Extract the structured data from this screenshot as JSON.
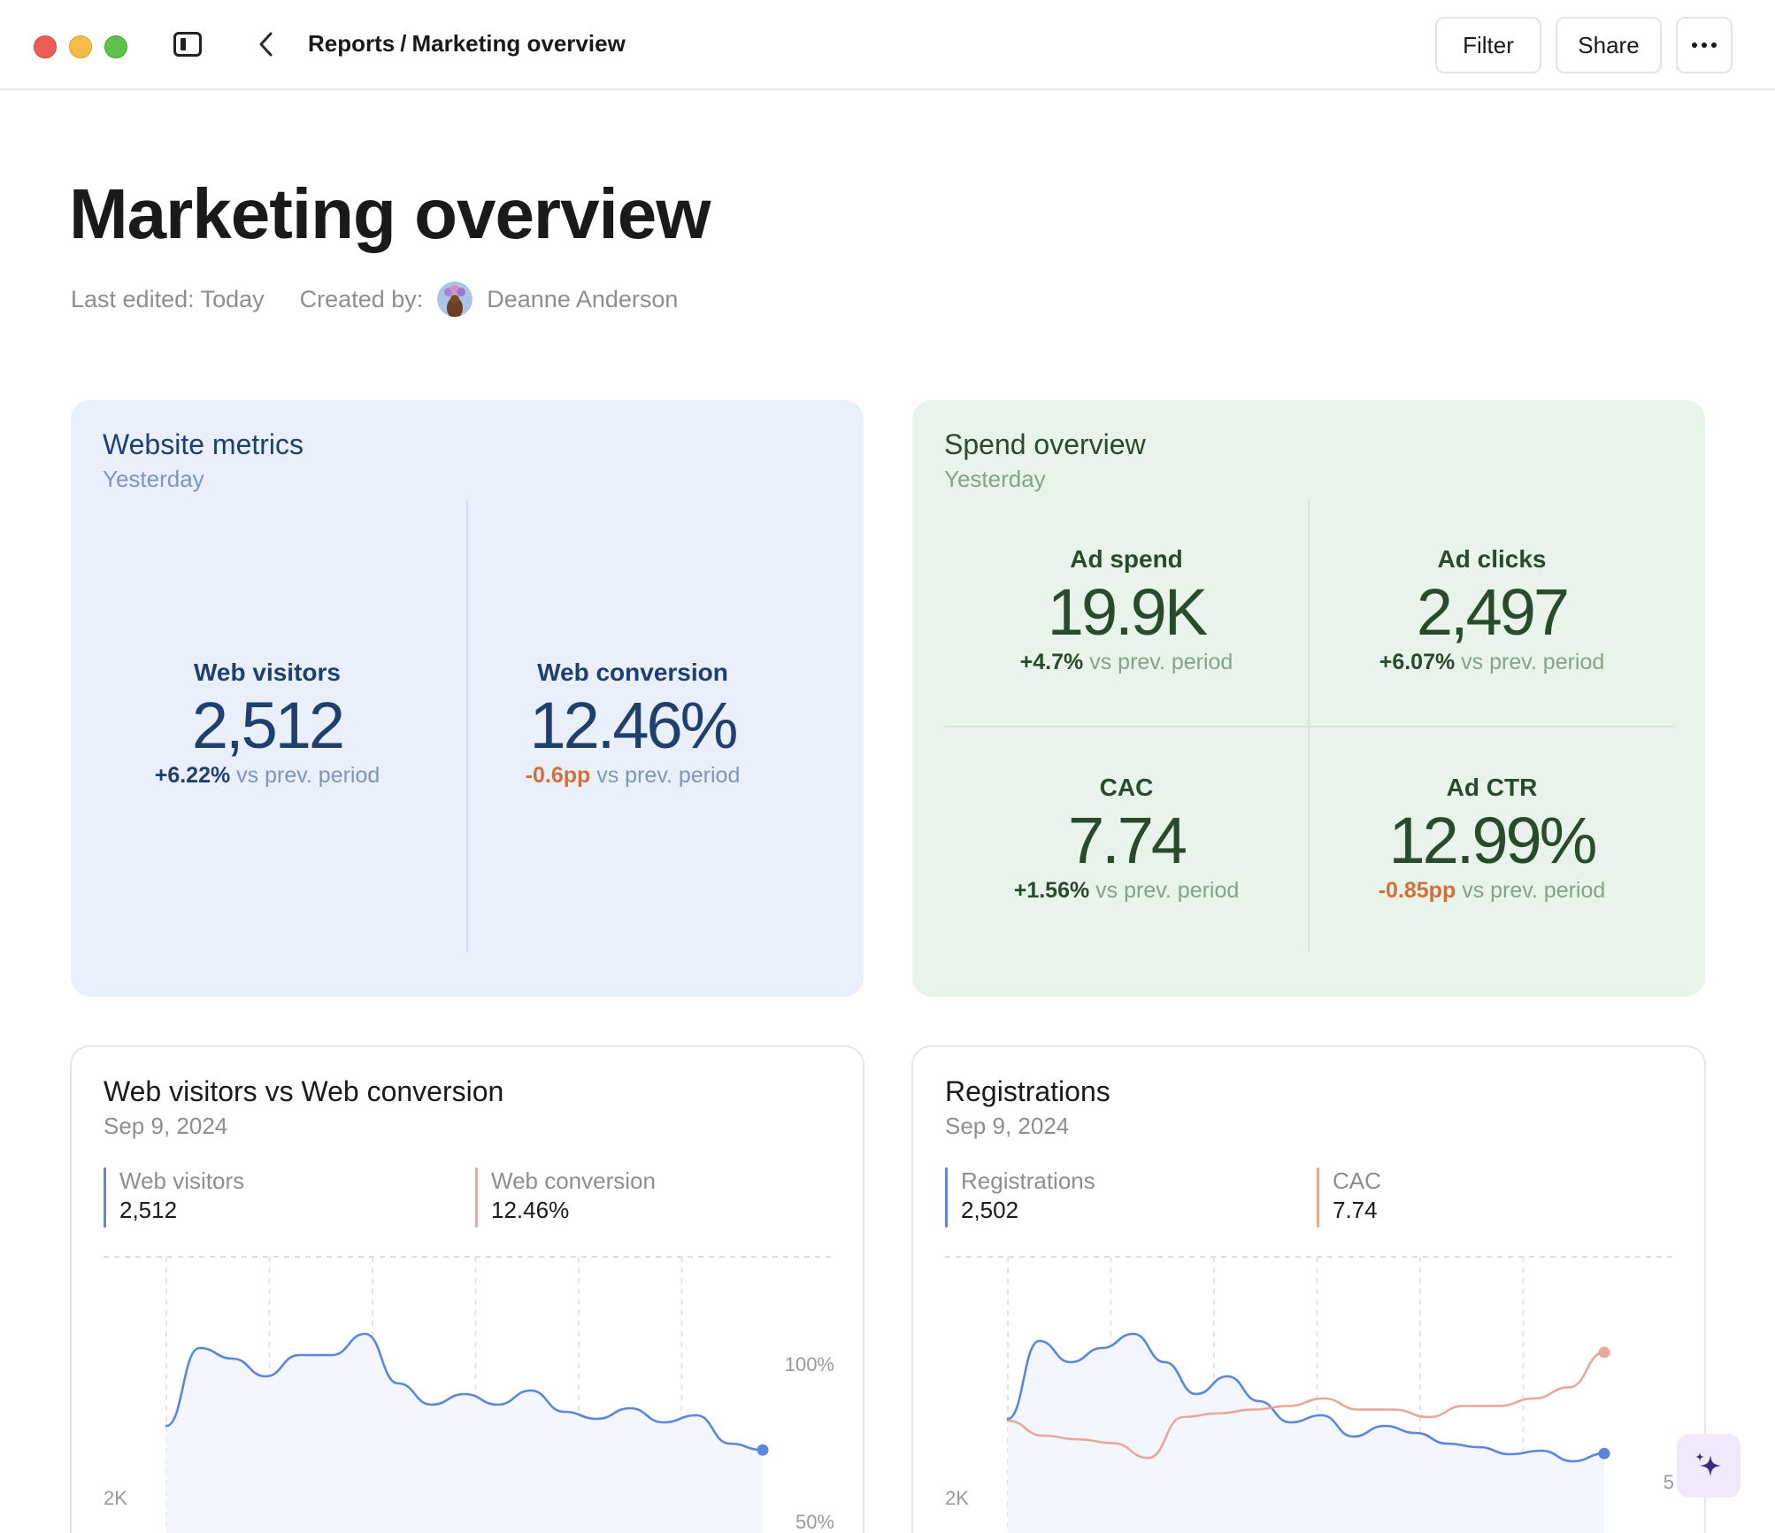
{
  "topbar": {
    "breadcrumb_parent": "Reports",
    "breadcrumb_sep": "/",
    "breadcrumb_current": "Marketing overview",
    "filter_label": "Filter",
    "share_label": "Share"
  },
  "header": {
    "title": "Marketing overview",
    "last_edited": "Last edited: Today",
    "created_by_label": "Created by:",
    "author": "Deanne Anderson"
  },
  "website_metrics": {
    "title": "Website metrics",
    "subtitle": "Yesterday",
    "metrics": [
      {
        "label": "Web visitors",
        "value": "2,512",
        "delta": "+6.22%",
        "delta_suffix": "vs prev. period"
      },
      {
        "label": "Web conversion",
        "value": "12.46%",
        "delta": "-0.6pp",
        "delta_suffix": "vs prev. period"
      }
    ]
  },
  "spend_overview": {
    "title": "Spend overview",
    "subtitle": "Yesterday",
    "metrics": [
      {
        "label": "Ad spend",
        "value": "19.9K",
        "delta": "+4.7%",
        "delta_suffix": "vs prev. period"
      },
      {
        "label": "Ad clicks",
        "value": "2,497",
        "delta": "+6.07%",
        "delta_suffix": "vs prev. period"
      },
      {
        "label": "CAC",
        "value": "7.74",
        "delta": "+1.56%",
        "delta_suffix": "vs prev. period"
      },
      {
        "label": "Ad CTR",
        "value": "12.99%",
        "delta": "-0.85pp",
        "delta_suffix": "vs prev. period"
      }
    ]
  },
  "colors": {
    "blue_series": "#5b86dd",
    "salmon_series": "#e8a99a",
    "positive": "#1f3f6e",
    "negative": "#d2703b",
    "web_card_bg": "#e9effb",
    "spend_card_bg": "#e8f3ea"
  },
  "charts": {
    "left": {
      "title": "Web visitors vs Web conversion",
      "date": "Sep 9, 2024",
      "legend": [
        {
          "name": "Web visitors",
          "value": "2,512",
          "color": "#5b86dd"
        },
        {
          "name": "Web conversion",
          "value": "12.46%",
          "color": "#e8a99a"
        }
      ],
      "y_left_tick": "2K",
      "y_right_ticks": [
        "100%",
        "50%"
      ]
    },
    "right": {
      "title": "Registrations",
      "date": "Sep 9, 2024",
      "legend": [
        {
          "name": "Registrations",
          "value": "2,502",
          "color": "#5b86dd"
        },
        {
          "name": "CAC",
          "value": "7.74",
          "color": "#e8a99a"
        }
      ],
      "y_left_tick": "2K",
      "y_right_tick": "5"
    }
  },
  "chart_data": [
    {
      "type": "line",
      "title": "Web visitors vs Web conversion",
      "series": [
        {
          "name": "Web visitors",
          "values": [
            2380,
            2600,
            2570,
            2520,
            2580,
            2580,
            2640,
            2500,
            2440,
            2470,
            2440,
            2480,
            2420,
            2400,
            2430,
            2390,
            2410,
            2330,
            2312
          ]
        }
      ]
    },
    {
      "type": "line",
      "title": "Registrations",
      "series": [
        {
          "name": "Registrations",
          "values": [
            2400,
            2620,
            2560,
            2600,
            2640,
            2560,
            2470,
            2520,
            2450,
            2390,
            2410,
            2350,
            2380,
            2360,
            2330,
            2320,
            2300,
            2310,
            2280,
            2302
          ]
        },
        {
          "name": "CAC",
          "values": [
            5.9,
            5.5,
            5.4,
            5.3,
            4.9,
            6.0,
            6.1,
            6.2,
            6.3,
            6.5,
            6.2,
            6.2,
            6.0,
            6.3,
            6.3,
            6.5,
            6.8,
            7.74
          ]
        }
      ]
    }
  ]
}
